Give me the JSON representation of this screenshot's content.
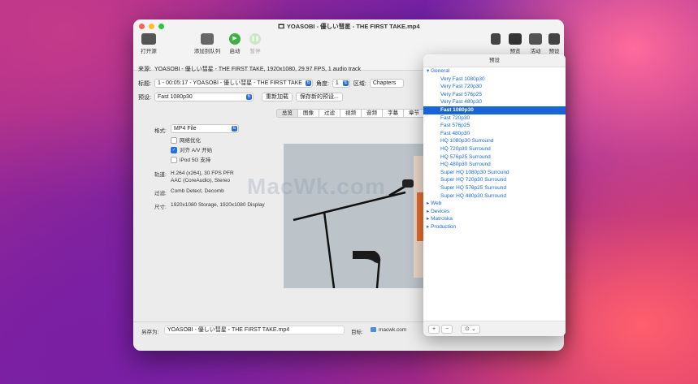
{
  "window": {
    "title": "YOASOBI - 優しい彗星 - THE FIRST TAKE.mp4",
    "traffic_colors": [
      "#ff5f57",
      "#febc2e",
      "#28c840"
    ]
  },
  "toolbar": {
    "open_source": "打开源",
    "add_queue": "添加到队列",
    "start": "启动",
    "pause": "暂停",
    "right_items": [
      "预览",
      "活动",
      "预设"
    ]
  },
  "source": {
    "label": "来源:",
    "value": "YOASOBI - 優しい彗星 - THE FIRST TAKE, 1920x1080, 29.97 FPS, 1 audio track"
  },
  "title_row": {
    "title_label": "标题:",
    "title_value": "1 - 00:05:17 - YOASOBI - 優しい彗星 - THE FIRST TAKE",
    "angle_label": "角度:",
    "angle_value": "1",
    "range_label": "区域:",
    "range_value": "Chapters"
  },
  "preset_row": {
    "label": "预设:",
    "value": "Fast 1080p30",
    "reload": "重新加载",
    "save_new": "保存新的预设..."
  },
  "tabs": [
    "总览",
    "图像",
    "过滤",
    "视频",
    "音频",
    "字幕",
    "章节"
  ],
  "summary": {
    "format_label": "格式:",
    "format_value": "MP4 File",
    "web_optimized": "网络优化",
    "align_av": "对齐 A/V 开始",
    "ipod": "iPod 5G 支持",
    "tracks_label": "轨道:",
    "tracks_line1": "H.264 (x264), 30 FPS PFR",
    "tracks_line2": "AAC (CoreAudio), Stereo",
    "filters_label": "过滤:",
    "filters_value": "Comb Detect, Decomb",
    "size_label": "尺寸:",
    "size_value": "1920x1080 Storage, 1920x1080 Display"
  },
  "watermark": "MacWk.com",
  "save": {
    "label": "另存为:",
    "value": "YOASOBI - 優しい彗星 - THE FIRST TAKE.mp4",
    "dest_label": "目标:",
    "dest_value": "macwk.com"
  },
  "presets_panel": {
    "title": "预设",
    "group_general": "General",
    "items": [
      "Very Fast 1080p30",
      "Very Fast 720p30",
      "Very Fast 576p25",
      "Very Fast 480p30",
      "Fast 1080p30",
      "Fast 720p30",
      "Fast 576p25",
      "Fast 480p30",
      "HQ 1080p30 Surround",
      "HQ 720p30 Surround",
      "HQ 576p25 Surround",
      "HQ 480p30 Surround",
      "Super HQ 1080p30 Surround",
      "Super HQ 720p30 Surround",
      "Super HQ 576p25 Surround",
      "Super HQ 480p30 Surround"
    ],
    "selected": "Fast 1080p30",
    "collapsed_groups": [
      "Web",
      "Devices",
      "Matroska",
      "Production"
    ],
    "add": "+",
    "remove": "−",
    "menu": "⊙ ⌄"
  }
}
